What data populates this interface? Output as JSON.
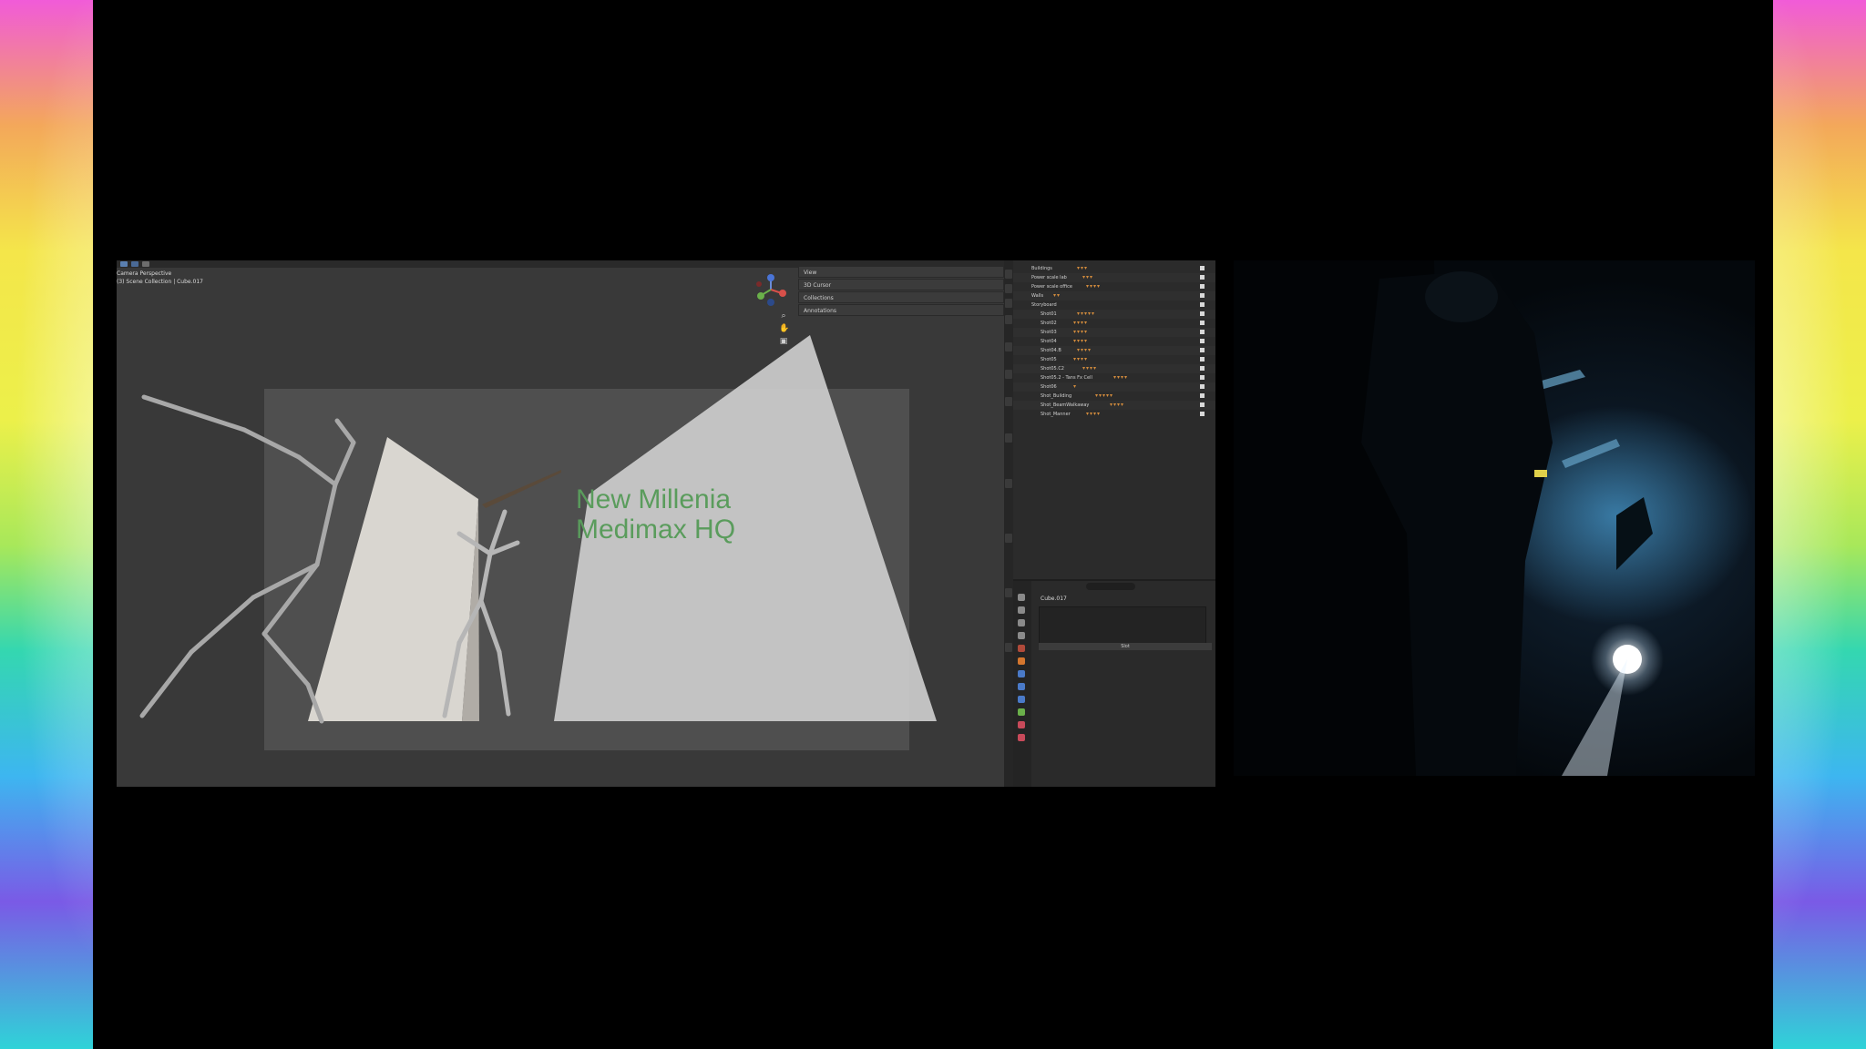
{
  "viewport": {
    "mode_label": "Camera Perspective",
    "collection_label": "(3) Scene Collection | Cube.017",
    "sign_lines": [
      "New Millenia",
      "Medimax HQ"
    ],
    "sign_color": "#5a9c5c"
  },
  "sidebar_panel": {
    "sections": [
      "View",
      "3D Cursor",
      "Collections",
      "Annotations"
    ]
  },
  "outliner": {
    "rows": [
      {
        "label": "Buildings",
        "indent": 1
      },
      {
        "label": "Power scale lab",
        "indent": 1
      },
      {
        "label": "Power scale office",
        "indent": 1
      },
      {
        "label": "Walls",
        "indent": 1
      },
      {
        "label": "Storyboard",
        "indent": 1
      },
      {
        "label": "Shot01",
        "indent": 2
      },
      {
        "label": "Shot02",
        "indent": 2
      },
      {
        "label": "Shot03",
        "indent": 2
      },
      {
        "label": "Shot04",
        "indent": 2
      },
      {
        "label": "Shot04.B",
        "indent": 2
      },
      {
        "label": "Shot05",
        "indent": 2
      },
      {
        "label": "Shot05.C2",
        "indent": 2
      },
      {
        "label": "Shot05.2 - Tans Fx Cell",
        "indent": 2
      },
      {
        "label": "Shot06",
        "indent": 2
      },
      {
        "label": "Shot_Building",
        "indent": 2
      },
      {
        "label": "Shot_BeamWalkaway",
        "indent": 2
      },
      {
        "label": "Shot_Manner",
        "indent": 2
      }
    ]
  },
  "properties": {
    "object_name": "Cube.017",
    "bar_label": "Slot"
  }
}
